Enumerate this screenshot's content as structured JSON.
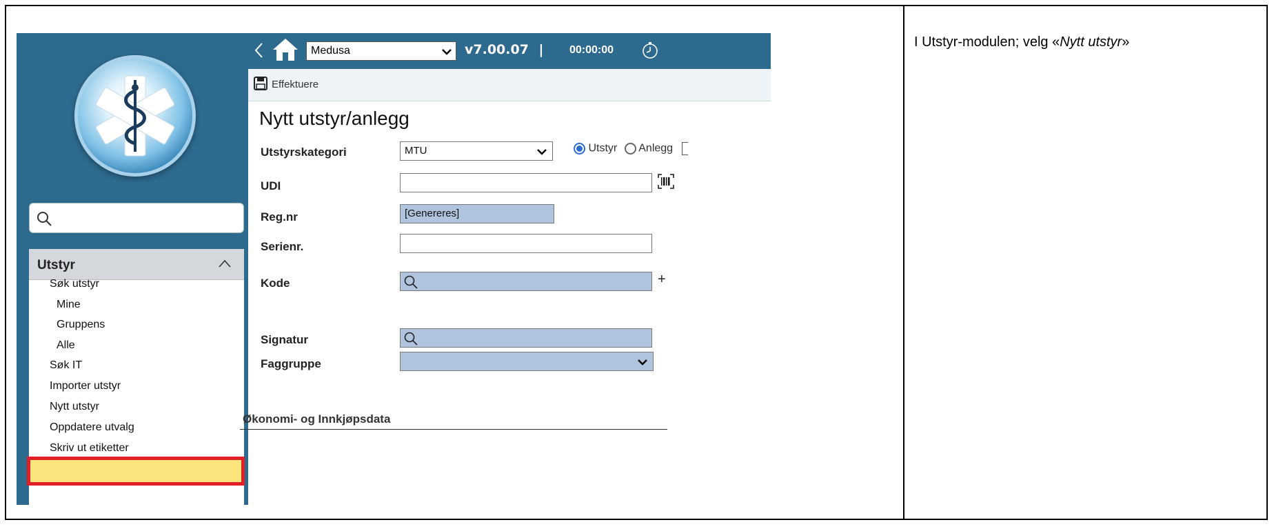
{
  "instruction": {
    "prefix": "I Utstyr-modulen; velg «",
    "emph": "Nytt utstyr",
    "suffix": "»"
  },
  "header": {
    "database": "Medusa",
    "version": "v7.00.07",
    "separator": "|",
    "timer": "00:00:00"
  },
  "toolbar": {
    "save_label": "Effektuere"
  },
  "sidebar": {
    "search_placeholder": "",
    "section_title": "Utstyr",
    "items": [
      {
        "label": "Søk utstyr"
      },
      {
        "label": "Mine"
      },
      {
        "label": "Gruppens"
      },
      {
        "label": "Alle"
      },
      {
        "label": "Søk IT"
      },
      {
        "label": "Importer utstyr"
      },
      {
        "label": "Nytt utstyr"
      },
      {
        "label": "Oppdatere utvalg"
      },
      {
        "label": "Skriv ut etiketter"
      }
    ]
  },
  "form": {
    "title": "Nytt utstyr/anlegg",
    "category_label": "Utstyrskategori",
    "category_value": "MTU",
    "radio_utstyr": "Utstyr",
    "radio_anlegg": "Anlegg",
    "udi_label": "UDI",
    "udi_value": "",
    "regnr_label": "Reg.nr",
    "regnr_value": "[Genereres]",
    "serienr_label": "Serienr.",
    "serienr_value": "",
    "kode_label": "Kode",
    "kode_add": "+",
    "signatur_label": "Signatur",
    "faggruppe_label": "Faggruppe",
    "section_econ": "Økonomi- og Innkjøpsdata"
  },
  "colors": {
    "sidebar_bg": "#2e6a8e",
    "highlight_border": "#e21f26",
    "highlight_fill": "#fde57e",
    "readonly_field": "#b0c4de"
  }
}
